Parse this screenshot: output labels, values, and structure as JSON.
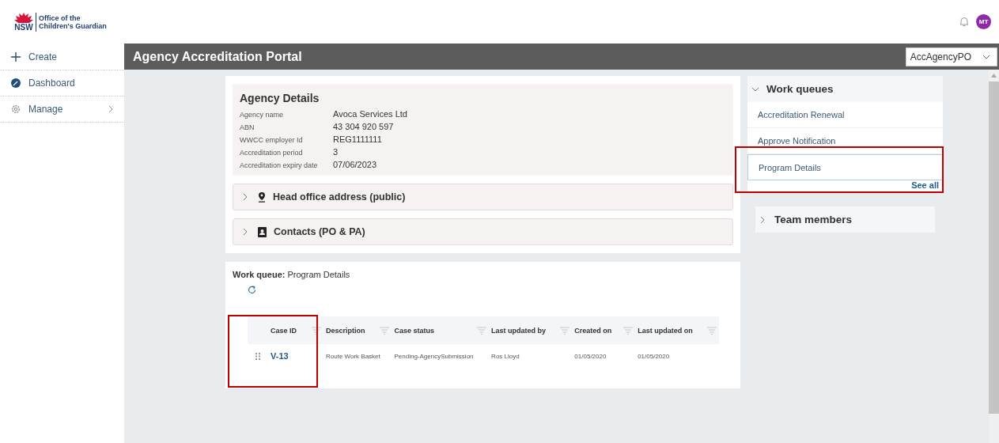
{
  "brand": {
    "logo_mark": "NSW",
    "name_line_1": "Office of the",
    "name_line_2": "Children's Guardian"
  },
  "header": {
    "avatar": "MT"
  },
  "sidebar": {
    "items": [
      {
        "label": "Create",
        "kind": "create",
        "has_submenu": false
      },
      {
        "label": "Dashboard",
        "kind": "dashboard",
        "has_submenu": false
      },
      {
        "label": "Manage",
        "kind": "manage",
        "has_submenu": true
      }
    ]
  },
  "title_bar": {
    "title": "Agency Accreditation Portal",
    "operator": "AccAgencyPO"
  },
  "agency_details": {
    "title": "Agency Details",
    "fields": [
      {
        "label": "Agency name",
        "value": "Avoca Services Ltd"
      },
      {
        "label": "ABN",
        "value": "43 304 920 597"
      },
      {
        "label": "WWCC employer Id",
        "value": "REG1111111"
      },
      {
        "label": "Accreditation period",
        "value": "3"
      },
      {
        "label": "Accreditation expiry date",
        "value": "07/06/2023"
      }
    ]
  },
  "sections": [
    {
      "label": "Head office address (public)",
      "kind": "address",
      "expanded": false
    },
    {
      "label": "Contacts (PO & PA)",
      "kind": "contacts",
      "expanded": false
    }
  ],
  "work_queue": {
    "label": "Work queue:",
    "name": "Program Details",
    "highlighted": true,
    "table": {
      "columns": [
        "Case ID",
        "Description",
        "Case status",
        "Last updated by",
        "Created on",
        "Last updated on"
      ],
      "rows": [
        {
          "cells": [
            "V-13",
            "Route Work Basket",
            "Pending-AgencySubmission",
            "Ros Lloyd",
            "01/05/2020",
            "01/05/2020"
          ]
        }
      ]
    }
  },
  "work_queues_panel": {
    "title": "Work queues",
    "expanded": true,
    "highlighted": true,
    "items": [
      {
        "label": "Accreditation Renewal",
        "selected": false
      },
      {
        "label": "Approve Notification",
        "selected": false
      },
      {
        "label": "Program Details",
        "selected": true
      }
    ],
    "see_all": "See all"
  },
  "team_members": {
    "title": "Team members",
    "expanded": false
  }
}
